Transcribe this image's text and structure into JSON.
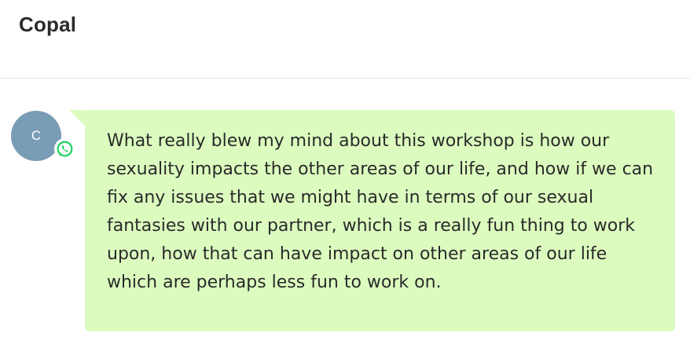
{
  "header": {
    "contact_name": "Copal"
  },
  "avatar": {
    "initial": "C",
    "color": "#7a9db6",
    "badge_icon": "whatsapp-icon",
    "badge_color": "#25d366"
  },
  "message": {
    "bubble_color": "#dcfcbf",
    "text": "What really blew my mind about this workshop is how our sexuality impacts the other areas of our life, and how if we can fix any issues that we might have in terms of our sexual fantasies with our partner, which is a really fun thing to work upon, how that can have impact on other areas of our life which are perhaps less fun to work on."
  }
}
